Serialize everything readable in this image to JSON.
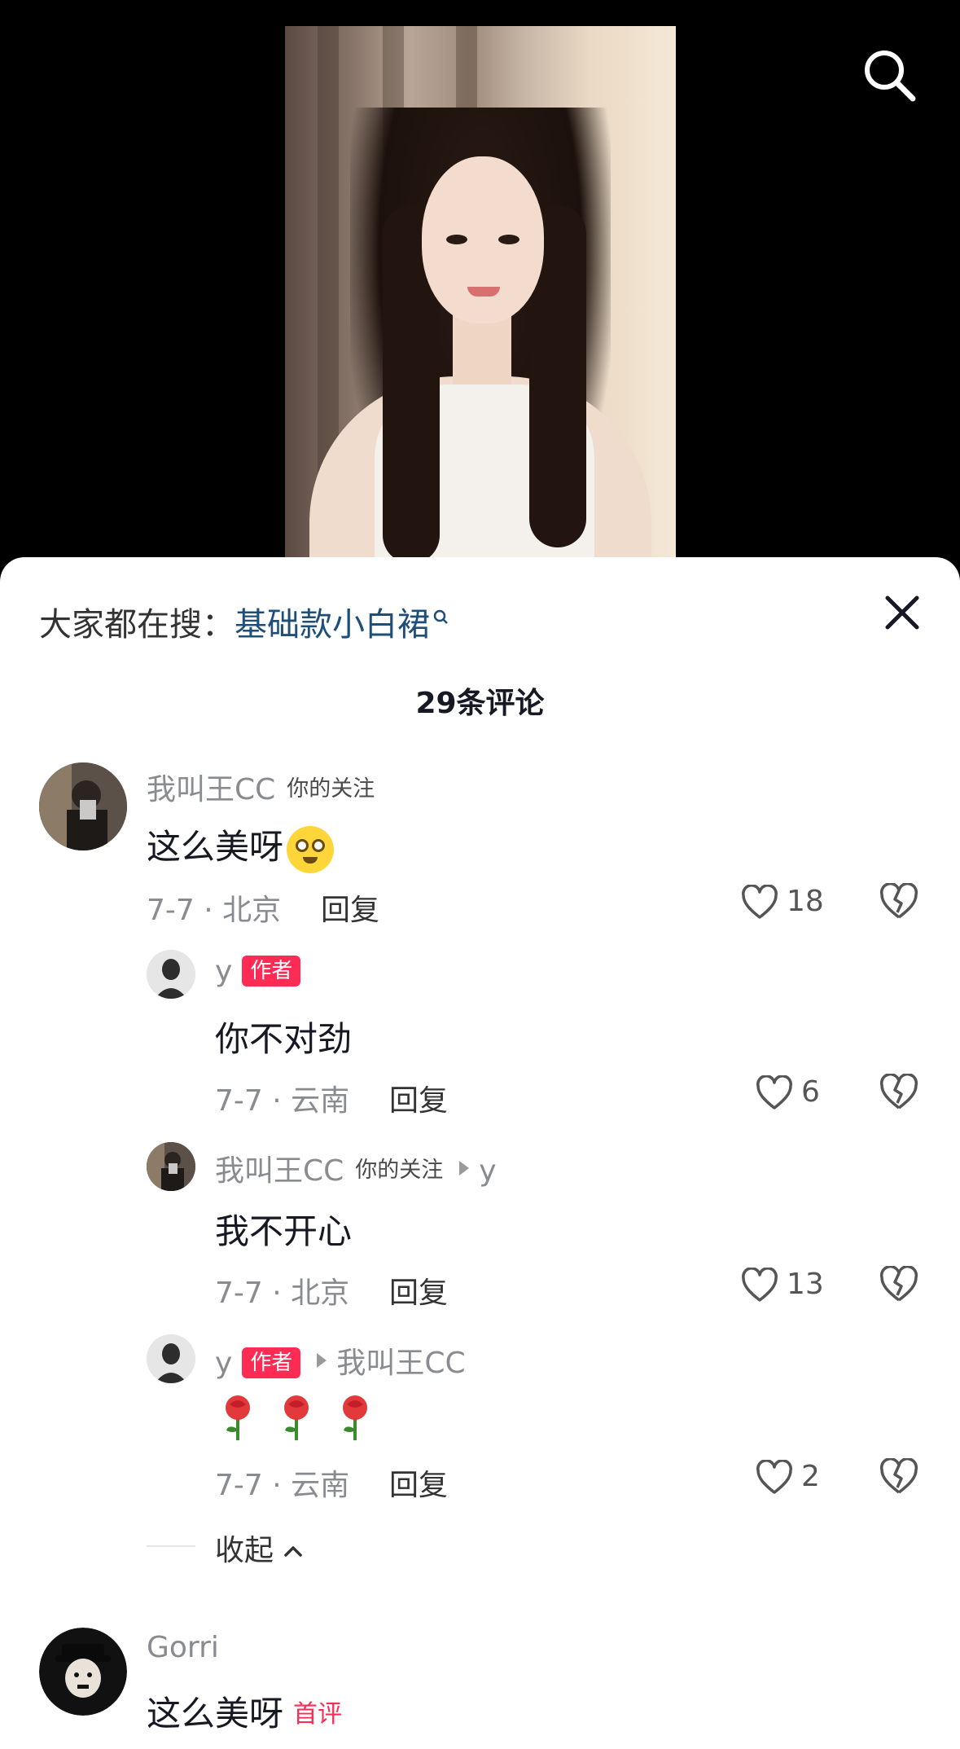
{
  "hot_search": {
    "prefix": "大家都在搜：",
    "keyword": "基础款小白裙"
  },
  "comment_count": "29条评论",
  "comments": [
    {
      "author": "我叫王CC",
      "follow_tag": "你的关注",
      "text": "这么美呀",
      "date_location": "7-7 · 北京",
      "reply": "回复",
      "likes": "18",
      "emoji": "smiling-face-emoji"
    }
  ],
  "replies": [
    {
      "author": "y",
      "badge": "作者",
      "text": "你不对劲",
      "date_location": "7-7 · 云南",
      "reply": "回复",
      "likes": "6"
    },
    {
      "author": "我叫王CC",
      "follow_tag": "你的关注",
      "reply_to": "y",
      "text": "我不开心",
      "date_location": "7-7 · 北京",
      "reply": "回复",
      "likes": "13"
    },
    {
      "author": "y",
      "badge": "作者",
      "reply_to": "我叫王CC",
      "text_emojis": [
        "rose",
        "rose",
        "rose"
      ],
      "date_location": "7-7 · 云南",
      "reply": "回复",
      "likes": "2"
    }
  ],
  "collapse_label": "收起",
  "comment2": {
    "author": "Gorri",
    "text": "这么美呀",
    "tag": "首评"
  },
  "colors": {
    "accent": "#fe2c55",
    "keyword": "#1f4e79",
    "muted": "#8a8b91"
  }
}
